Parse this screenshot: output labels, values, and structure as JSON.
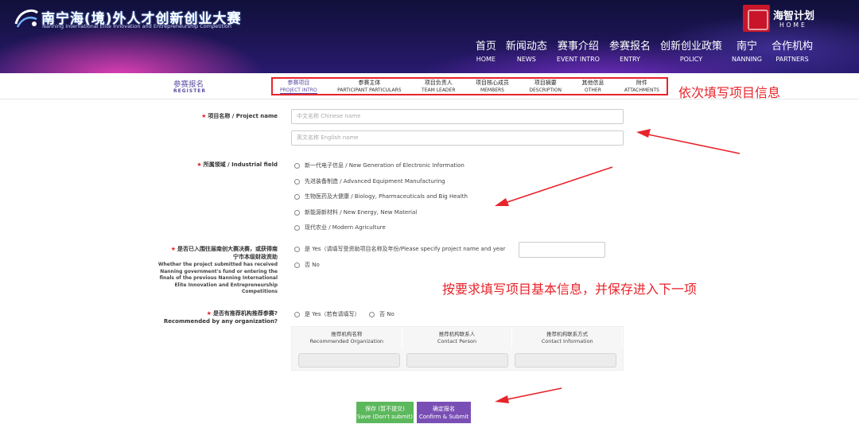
{
  "header": {
    "title": "南宁海(境)外人才创新创业大赛",
    "subtitle": "Nanning International Elite Innovation and Entrepreneurship Competition",
    "brand": {
      "name": "海智计划",
      "en": "HOME"
    },
    "nav": [
      {
        "zh": "首页",
        "en": "HOME"
      },
      {
        "zh": "新闻动态",
        "en": "NEWS"
      },
      {
        "zh": "赛事介绍",
        "en": "EVENT INTRO"
      },
      {
        "zh": "参赛报名",
        "en": "ENTRY"
      },
      {
        "zh": "创新创业政策",
        "en": "POLICY"
      },
      {
        "zh": "南宁",
        "en": "NANNING"
      },
      {
        "zh": "合作机构",
        "en": "PARTNERS"
      }
    ]
  },
  "register": {
    "title": "参赛报名",
    "subtitle": "REGISTER"
  },
  "steps": [
    {
      "zh": "参赛项目",
      "en": "PROJECT INTRO",
      "active": true
    },
    {
      "zh": "参赛主体",
      "en": "PARTICIPANT PARTICULARS"
    },
    {
      "zh": "项目负责人",
      "en": "TEAM LEADER"
    },
    {
      "zh": "项目核心成员",
      "en": "MEMBERS"
    },
    {
      "zh": "项目摘要",
      "en": "DESCRIPTION"
    },
    {
      "zh": "其他信息",
      "en": "OTHER"
    },
    {
      "zh": "附件",
      "en": "ATTACHMENTS"
    }
  ],
  "annotations": {
    "hint_steps": "依次填写项目信息",
    "hint_form": "按要求填写项目基本信息，并保存进入下一项"
  },
  "form": {
    "project_name": {
      "label": "项目名称 / Project name",
      "placeholder_cn": "中文名称 Chinese name",
      "placeholder_en": "英文名称 English name"
    },
    "industry": {
      "label": "所属领域 / Industrial field",
      "options": [
        "新一代电子信息 / New Generation of Electronic Information",
        "先进装备制造 / Advanced Equipment Manufacturing",
        "生物医药及大健康 / Biology, Pharmaceuticals and Big Health",
        "新能源新材料 / New Energy, New Material",
        "现代农业 / Modern Agriculture"
      ]
    },
    "funded": {
      "label_cn_1": "是否已入围往届南创大赛决赛，或获得南",
      "label_cn_2": "宁市本级财政资助",
      "label_en": [
        "Whether the project submitted has received",
        "Nanning government's fund or entering the",
        "finals of the previous Nanning International",
        "Elite Innovation and Entrepreneurship",
        "Competitions"
      ],
      "yes": "是 Yes（请填写受资助项目名称及年份/Please specify project name and year",
      "no": "否 No"
    },
    "recommended": {
      "label_cn": "是否有推荐机构推荐参赛?",
      "label_en": "Recommended by any organization?",
      "yes": "是 Yes（若有请填写）",
      "no": "否 No",
      "columns": [
        {
          "zh": "推荐机构名称",
          "en": "Recommended Organization"
        },
        {
          "zh": "推荐机构联系人",
          "en": "Contact Person"
        },
        {
          "zh": "推荐机构联系方式",
          "en": "Contact Information"
        }
      ]
    }
  },
  "buttons": {
    "save": {
      "zh": "保存 (暂不提交)",
      "en": "Save (Don't submit)"
    },
    "submit": {
      "zh": "确定报名",
      "en": "Confirm & Submit"
    }
  },
  "colors": {
    "accent": "#5a4aa0",
    "annotation_red": "#e8242b",
    "save_green": "#5cb85c",
    "submit_purple": "#7a4fb5"
  }
}
